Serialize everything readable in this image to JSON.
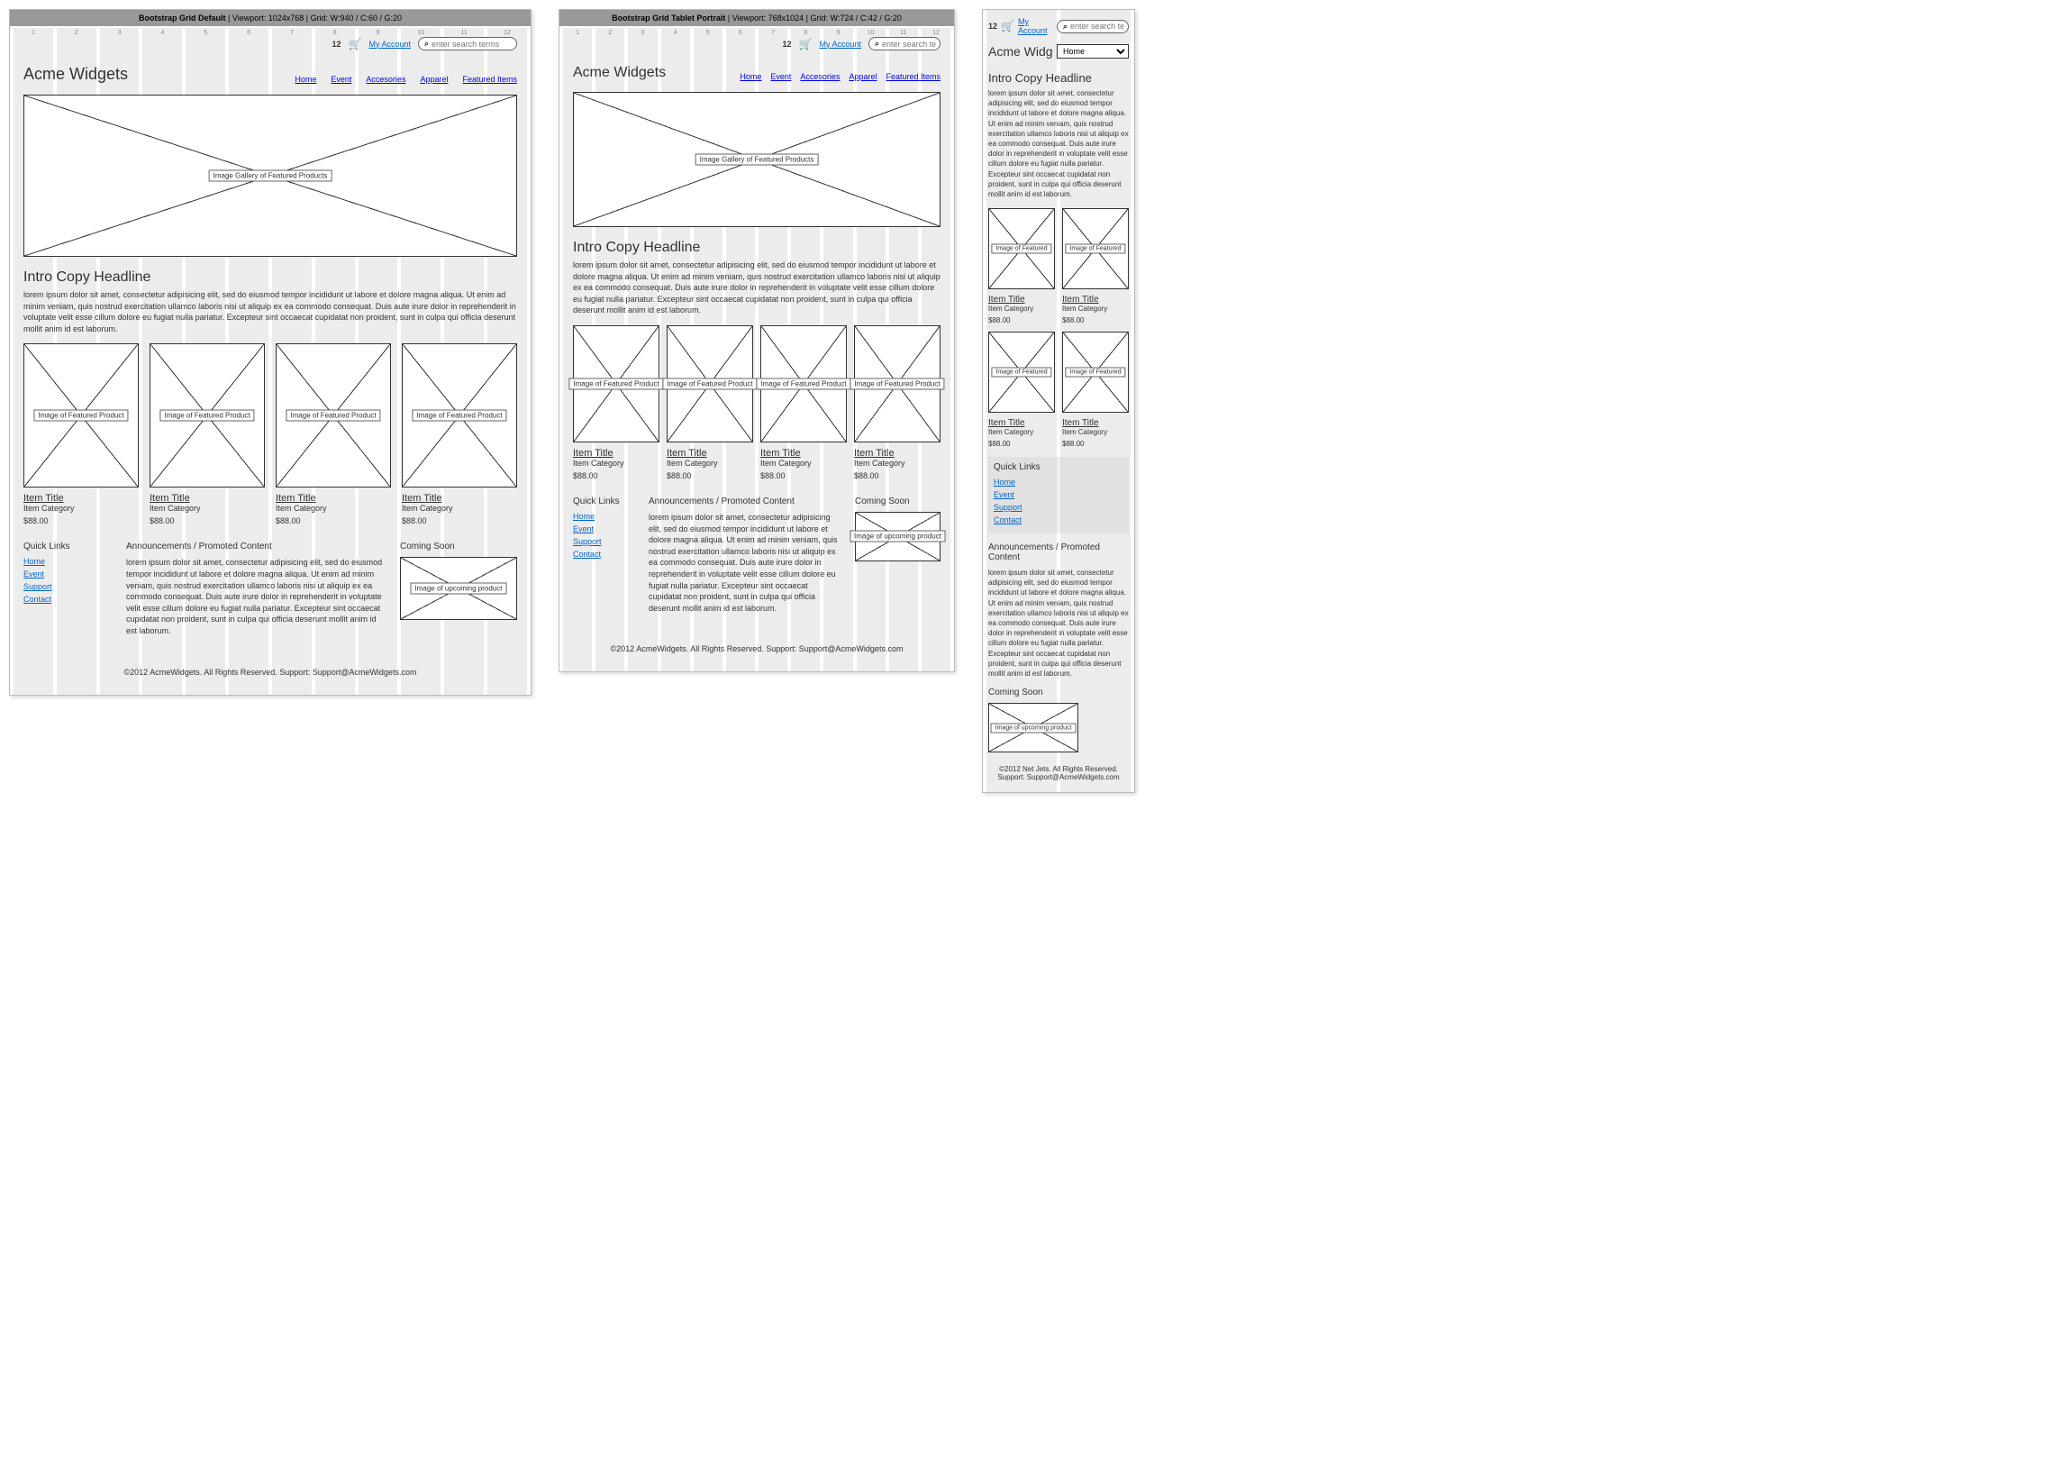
{
  "layouts": {
    "default": {
      "title": "Bootstrap Grid Default",
      "viewport": "1024x768",
      "grid": "W:940 / C:60 / G:20"
    },
    "tablet": {
      "title": "Bootstrap Grid Tablet Portrait",
      "viewport": "768x1024",
      "grid": "W:724 / C:42 / G:20"
    },
    "mobile": {
      "title": "",
      "viewport": "",
      "grid": ""
    }
  },
  "topbar": {
    "cart_count": "12",
    "my_account": "My Account",
    "search_placeholder": "enter search terms"
  },
  "brand": "Acme Widgets",
  "brand_mobile": "Acme Widg",
  "mobile_nav_selected": "Home",
  "nav": [
    "Home",
    "Event",
    "Accesories",
    "Apparel",
    "Featured Items"
  ],
  "hero_label": "Image Gallery of Featured Products",
  "intro": {
    "headline": "Intro Copy Headline",
    "body_long": "lorem ipsum dolor sit amet, consectetur adipisicing elit, sed do eiusmod tempor incididunt ut labore et dolore magna aliqua. Ut enim ad minim veniam, quis nostrud exercitation ullamco laboris nisi ut aliquip ex ea commodo consequat. Duis aute irure dolor in reprehenderit in voluptate velit esse cillum dolore eu fugiat nulla pariatur. Excepteur sint occaecat cupidatat non proident, sunt in culpa qui officia deserunt mollit anim id est laborum.",
    "body_tablet": "lorem ipsum dolor sit amet, consectetur adipisicing elit, sed do eiusmod tempor incididunt ut labore et dolore magna aliqua. Ut enim ad minim veniam, quis nostrud exercitation ullamco laboris nisi ut aliquip ex ea commodo consequat. Duis aute irure dolor in reprehenderit in voluptate velit esse cillum dolore eu fugiat nulla pariatur. Excepteur sint occaecat cupidatat non proident, sunt in culpa qui officia deserunt mollit anim id est laborum."
  },
  "product_img_label": "Image of Featured Product",
  "product_img_label_short": "Image of Featured",
  "product": {
    "title": "Item Title",
    "category": "Item Category",
    "price": "$88.00"
  },
  "footer": {
    "quicklinks_h": "Quick Links",
    "links": [
      "Home",
      "Event",
      "Support",
      "Contact"
    ],
    "announce_h": "Announcements / Promoted Content",
    "announce_body": "lorem ipsum dolor sit amet, consectetur adipisicing elit, sed do eiusmod tempor incididunt ut labore et dolore magna aliqua. Ut enim ad minim veniam, quis nostrud exercitation ullamco laboris nisi ut aliquip ex ea commodo consequat. Duis aute irure dolor in reprehenderit in voluptate velit esse cillum dolore eu fugiat nulla pariatur. Excepteur sint occaecat cupidatat non proident, sunt in culpa qui officia deserunt mollit anim id est laborum.",
    "soon_h": "Coming Soon",
    "soon_label": "Image of upcoming product",
    "copyright_default": "©2012 AcmeWidgets.   All Rights Reserved.   Support: Support@AcmeWidgets.com",
    "copyright_mobile1": "©2012 Net Jets.   All Rights Reserved.",
    "copyright_mobile2": "Support: Support@AcmeWidgets.com"
  },
  "bar_sep": "  |  ",
  "bar_vp_label": "Viewport: ",
  "bar_grid_label": "Grid: "
}
